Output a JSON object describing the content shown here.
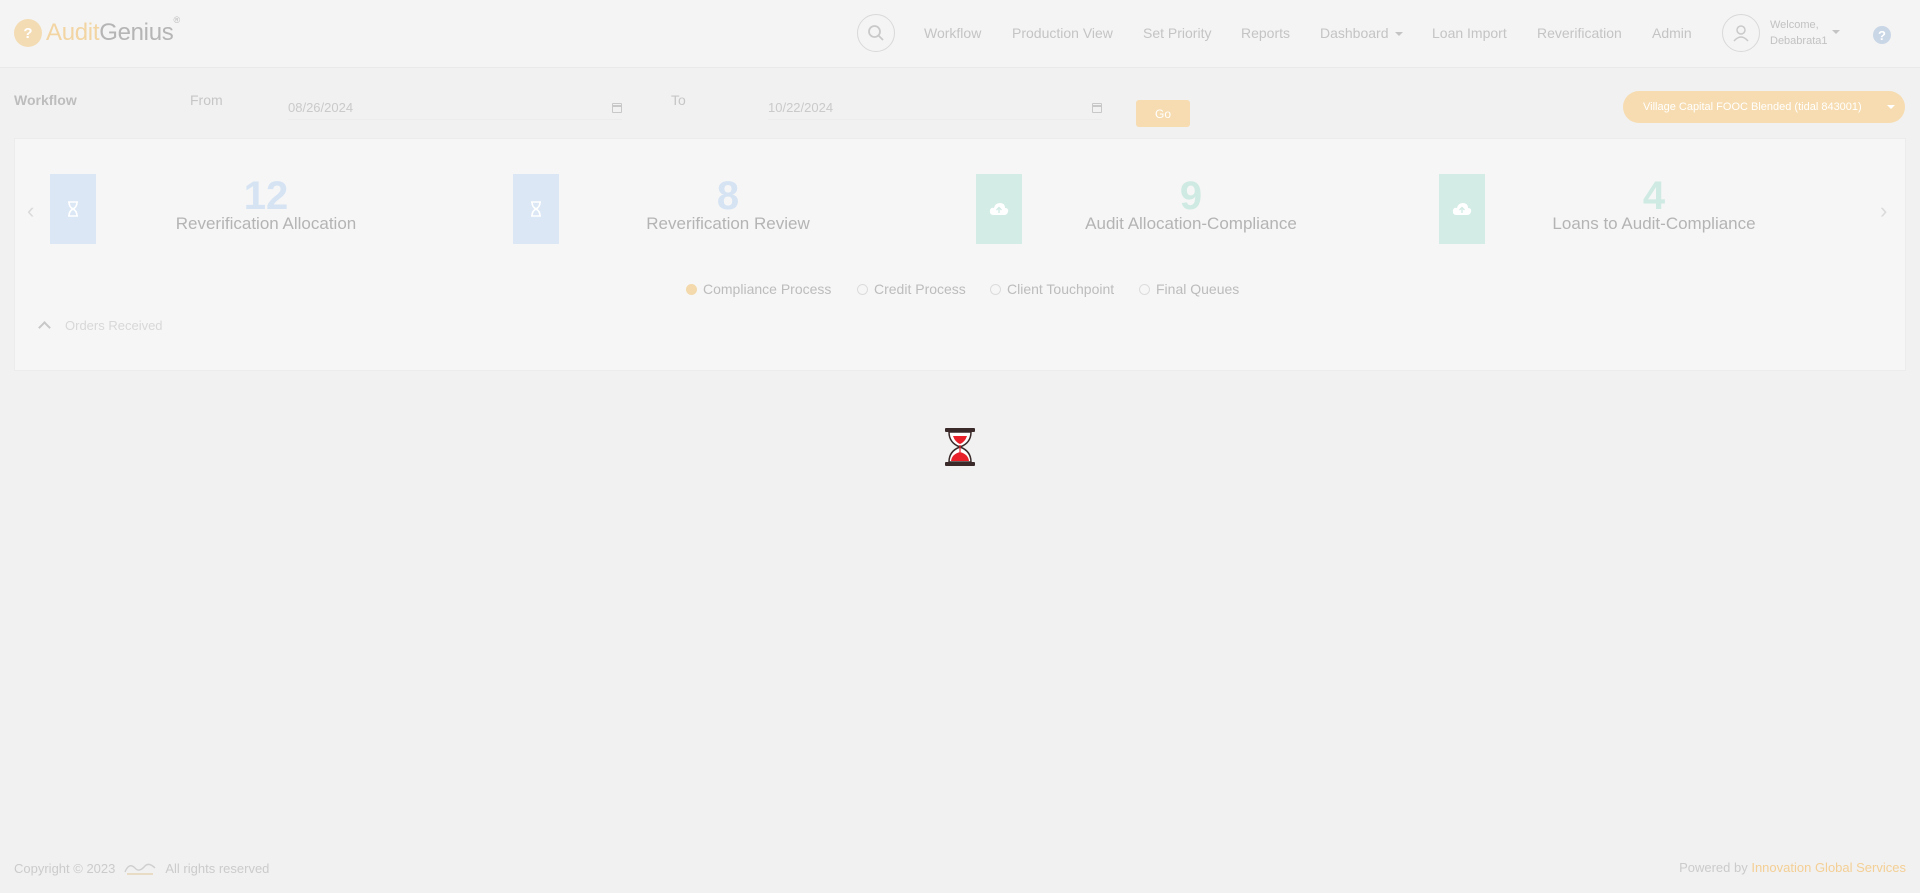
{
  "app": {
    "logo_part1": "Audit",
    "logo_part2": "Genius",
    "logo_tm": "®"
  },
  "nav": {
    "items": [
      {
        "label": "Workflow"
      },
      {
        "label": "Production View"
      },
      {
        "label": "Set Priority"
      },
      {
        "label": "Reports"
      },
      {
        "label": "Dashboard"
      },
      {
        "label": "Loan Import"
      },
      {
        "label": "Reverification"
      },
      {
        "label": "Admin"
      }
    ],
    "search_icon": "search-icon",
    "help_icon": "help-icon"
  },
  "user": {
    "welcome": "Welcome,",
    "name": "Debabrata1"
  },
  "filters": {
    "page_label": "Workflow",
    "from_label": "From",
    "from_value": "08/26/2024",
    "to_label": "To",
    "to_value": "10/22/2024",
    "go_label": "Go",
    "client_selected": "Village Capital FOOC Blended (tidal 843001)"
  },
  "stats": [
    {
      "value": "12",
      "label": "Reverification Allocation",
      "icon": "hourglass-icon",
      "color": "#d3e2f2",
      "number_color": "#d5e3f3"
    },
    {
      "value": "8",
      "label": "Reverification Review",
      "icon": "hourglass-icon",
      "color": "#d3e2f2",
      "number_color": "#d5e3f3"
    },
    {
      "value": "9",
      "label": "Audit Allocation-Compliance",
      "icon": "cloud-upload-icon",
      "color": "#cbe9e0",
      "number_color": "#cfeae2"
    },
    {
      "value": "4",
      "label": "Loans to Audit-Compliance",
      "icon": "cloud-upload-icon",
      "color": "#cbe9e0",
      "number_color": "#cfeae2"
    }
  ],
  "process_filters": [
    {
      "label": "Compliance Process",
      "selected": true
    },
    {
      "label": "Credit Process",
      "selected": false
    },
    {
      "label": "Client Touchpoint",
      "selected": false
    },
    {
      "label": "Final Queues",
      "selected": false
    }
  ],
  "orders_section": {
    "label": "Orders Received"
  },
  "footer": {
    "copyright": "Copyright © 2023",
    "rights": "All rights reserved",
    "powered_by": "Powered by",
    "company": "Innovation Global Services"
  },
  "loader": {
    "icon": "hourglass-loading-icon"
  }
}
